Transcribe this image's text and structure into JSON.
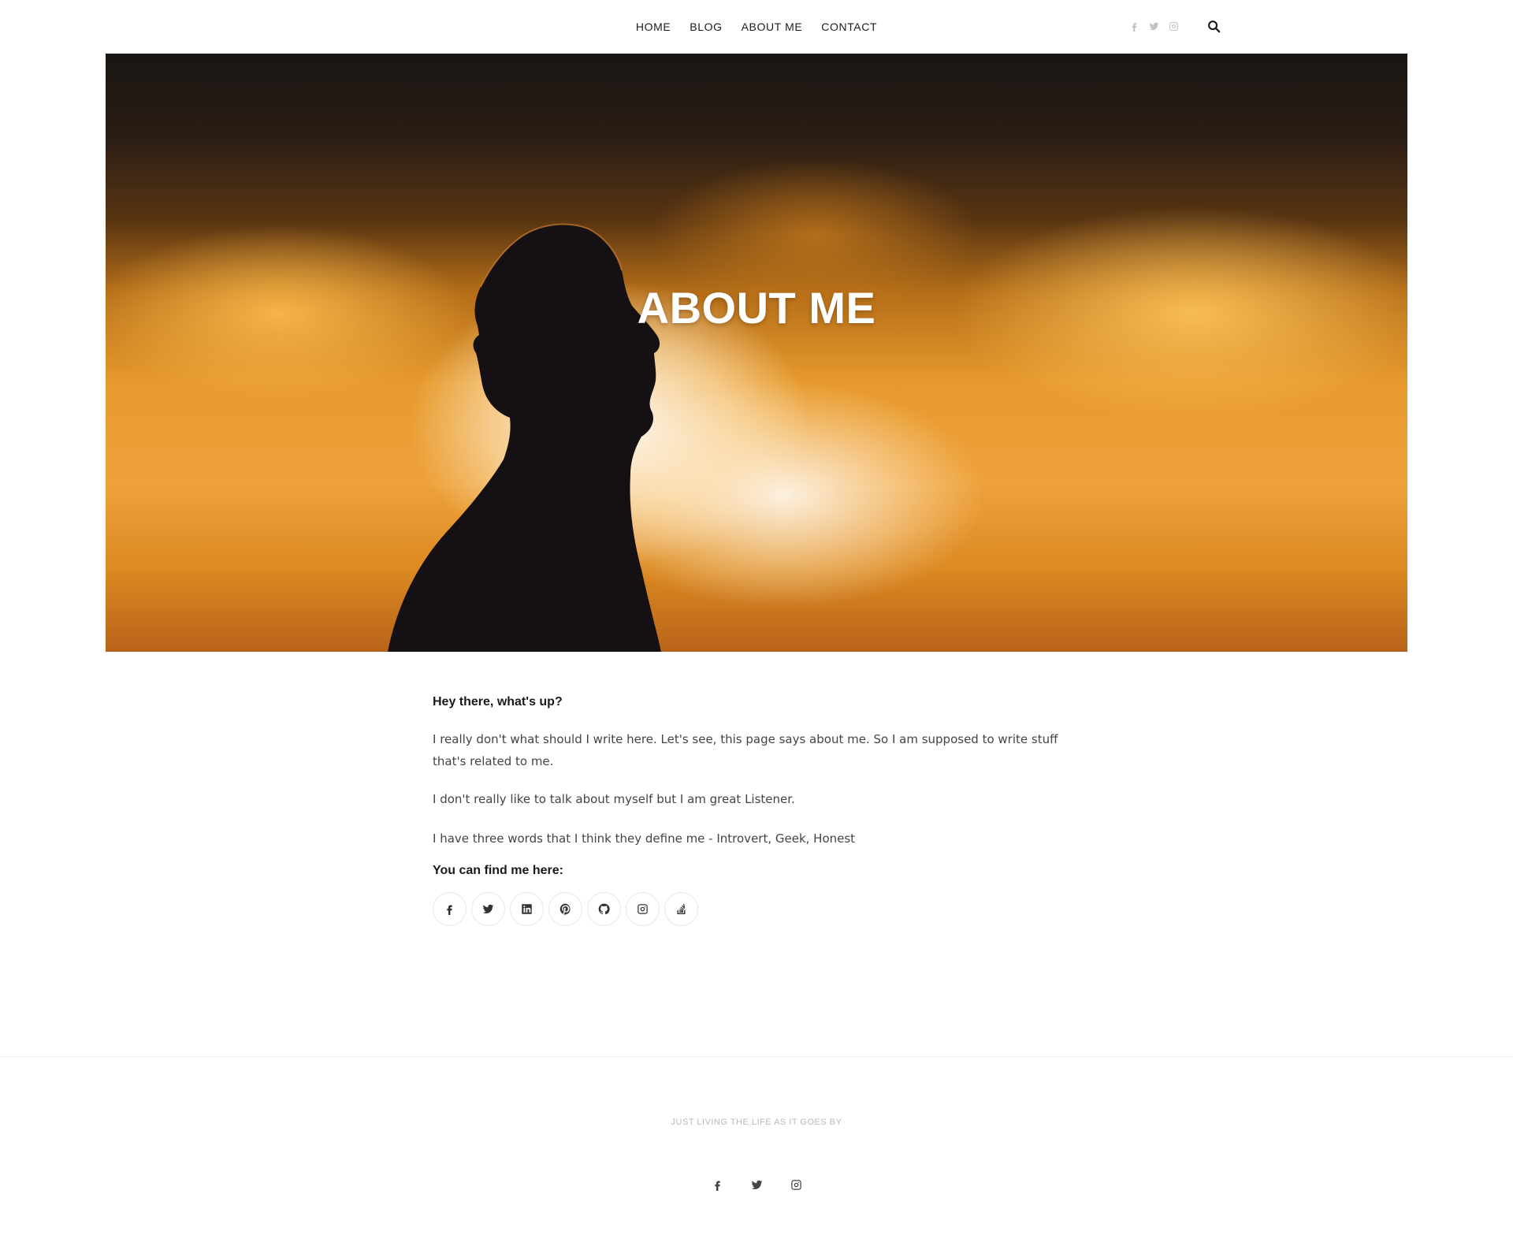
{
  "nav": {
    "items": [
      {
        "label": "HOME"
      },
      {
        "label": "BLOG"
      },
      {
        "label": "ABOUT ME"
      },
      {
        "label": "CONTACT"
      }
    ],
    "social_icons": [
      "facebook-icon",
      "twitter-icon",
      "instagram-icon"
    ],
    "search_icon": "search-icon"
  },
  "hero": {
    "title": "ABOUT ME"
  },
  "content": {
    "intro_heading": "Hey there, what's up?",
    "paragraphs": [
      "I really don't what should I write here. Let's see, this page says about me. So I am supposed to write stuff that's related to me.",
      "I don't really like to talk about myself but I am great Listener.",
      "I have three words that I think they define me - Introvert, Geek, Honest"
    ],
    "find_heading": "You can find me here:",
    "social_links": [
      "facebook-icon",
      "twitter-icon",
      "linkedin-icon",
      "pinterest-icon",
      "github-icon",
      "instagram-icon",
      "stackoverflow-icon"
    ]
  },
  "footer": {
    "tagline": "JUST LIVING THE LIFE AS IT GOES BY",
    "social_icons": [
      "facebook-icon",
      "twitter-icon",
      "instagram-icon"
    ]
  },
  "colors": {
    "text_dark": "#1a1a1a",
    "text_body": "#444444",
    "header_social": "#c2c2c2",
    "tagline": "#b9b9b9",
    "hero_orange": "#e79a2d"
  }
}
